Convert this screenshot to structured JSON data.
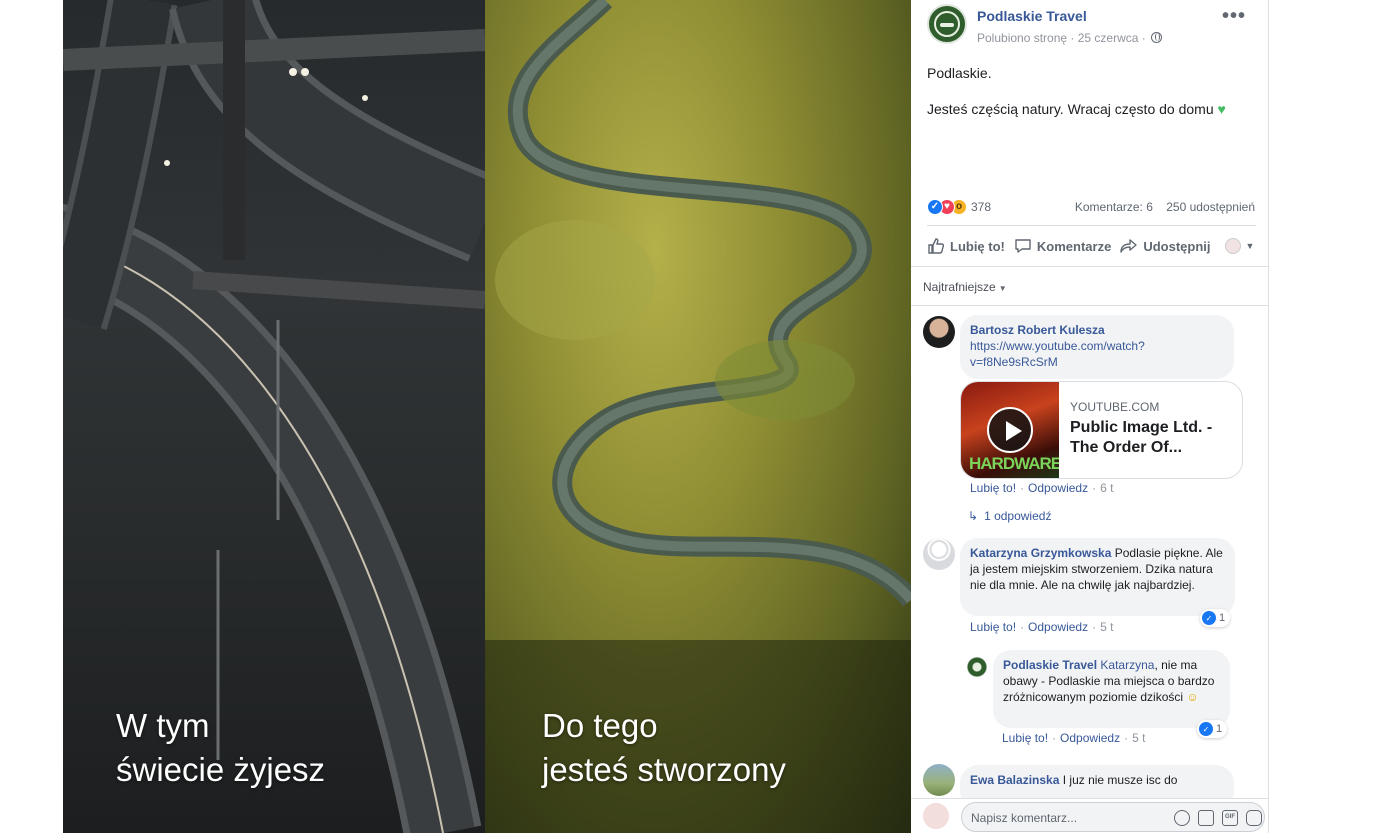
{
  "photo": {
    "left_caption": [
      "W tym",
      "świecie żyjesz"
    ],
    "right_caption": [
      "Do tego",
      "jesteś stworzony"
    ]
  },
  "post": {
    "page_name": "Podlaskie Travel",
    "meta": "Polubiono stronę · 25 czerwca ·",
    "text_line1": "Podlaskie.",
    "text_line2": "Jesteś częścią natury. Wracaj często do domu",
    "reaction_count": "378",
    "comments_count": "Komentarze: 6",
    "shares_count": "250 udostępnień",
    "actions": {
      "like": "Lubię to!",
      "comment": "Komentarze",
      "share": "Udostępnij"
    }
  },
  "sort": {
    "label": "Najtrafniejsze"
  },
  "comments": [
    {
      "author": "Bartosz Robert Kulesza",
      "link": "https://www.youtube.com/watch?v=f8Ne9sRcSrM",
      "link_line1": "https://www.youtube.com/watch?",
      "link_line2": "v=f8Ne9sRcSrM",
      "card_domain": "YOUTUBE.COM",
      "card_title": "Public Image Ltd. - The Order Of...",
      "card_thumb_text": "HARDWARE",
      "like": "Lubię to!",
      "reply": "Odpowiedz",
      "time": "6 t",
      "replies": "1 odpowiedź"
    },
    {
      "author": "Katarzyna Grzymkowska",
      "text": "Podlasie piękne. Ale ja jestem miejskim stworzeniem. Dzika natura nie dla mnie. Ale na chwilę jak najbardziej.",
      "like": "Lubię to!",
      "reply": "Odpowiedz",
      "time": "5 t",
      "likes": "1"
    },
    {
      "author": "Podlaskie Travel",
      "mention": "Katarzyna",
      "text": ", nie ma obawy - Podlaskie ma miejsca o bardzo zróżnicowanym poziomie dzikości",
      "like": "Lubię to!",
      "reply": "Odpowiedz",
      "time": "5 t",
      "likes": "1"
    },
    {
      "author": "Ewa Balazinska",
      "text": "I juz nie musze isc do"
    }
  ],
  "comment_input": {
    "placeholder": "Napisz komentarz..."
  },
  "colors": {
    "link": "#385898",
    "muted": "#90949c",
    "bubble": "#f2f3f5",
    "like_blue": "#1877f2"
  }
}
